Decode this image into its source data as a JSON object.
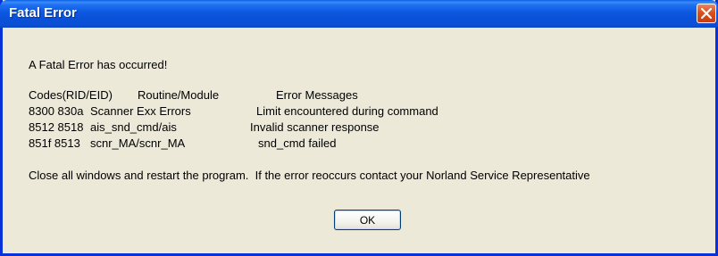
{
  "window": {
    "title": "Fatal Error",
    "close_icon": "close-icon"
  },
  "message": {
    "heading": "A Fatal Error has occurred!",
    "table": {
      "headers": [
        "Codes(RID/EID)",
        "Routine/Module",
        "Error Messages"
      ],
      "rows": [
        [
          "8300 830a",
          "Scanner Exx Errors",
          "Limit encountered during command"
        ],
        [
          "8512 8518",
          "ais_snd_cmd/ais",
          "Invalid scanner response"
        ],
        [
          "851f 8513",
          "scnr_MA/scnr_MA",
          "snd_cmd failed"
        ]
      ]
    },
    "instruction": "Close all windows and restart the program.  If the error reoccurs contact your Norland Service Representative"
  },
  "buttons": {
    "ok_label": "OK"
  },
  "colors": {
    "titlebar": "#0b4fd4",
    "frame": "#0831d9",
    "body": "#ece9d8",
    "close_button": "#d9501e"
  }
}
